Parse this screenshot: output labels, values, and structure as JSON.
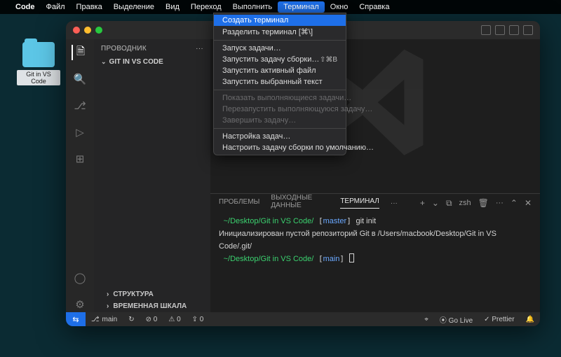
{
  "menubar": {
    "app": "Code",
    "items": [
      "Файл",
      "Правка",
      "Выделение",
      "Вид",
      "Переход",
      "Выполнить",
      "Терминал",
      "Окно",
      "Справка"
    ],
    "active_index": 6
  },
  "dropdown": {
    "items": [
      {
        "label": "Создать терминал",
        "shortcut": "",
        "hl": true
      },
      {
        "label": "Разделить терминал [⌘\\]",
        "shortcut": ""
      },
      {
        "sep": true
      },
      {
        "label": "Запуск задачи…",
        "shortcut": ""
      },
      {
        "label": "Запустить задачу сборки…",
        "shortcut": "⇧⌘B"
      },
      {
        "label": "Запустить активный файл",
        "shortcut": ""
      },
      {
        "label": "Запустить выбранный текст",
        "shortcut": ""
      },
      {
        "sep": true
      },
      {
        "label": "Показать выполняющиеся задачи…",
        "disabled": true
      },
      {
        "label": "Перезапустить выполняющуюся задачу…",
        "disabled": true
      },
      {
        "label": "Завершить задачу…",
        "disabled": true
      },
      {
        "sep": true
      },
      {
        "label": "Настройка задач…",
        "shortcut": ""
      },
      {
        "label": "Настроить задачу сборки по умолчанию…",
        "shortcut": ""
      }
    ]
  },
  "desktop": {
    "folder_label": "Git in VS Code"
  },
  "sidebar": {
    "title": "ПРОВОДНИК",
    "folder": "GIT IN VS CODE",
    "collapsed": [
      "СТРУКТУРА",
      "ВРЕМЕННАЯ ШКАЛА"
    ]
  },
  "panel": {
    "tabs": [
      "ПРОБЛЕМЫ",
      "ВЫХОДНЫЕ ДАННЫЕ",
      "ТЕРМИНАЛ"
    ],
    "active_tab": 2,
    "more": "···",
    "right": {
      "plus": "+",
      "add_dd": "⌄",
      "shell_icon": "⧉",
      "shell": "zsh",
      "trash": "🗑",
      "more": "···",
      "up": "⌃",
      "close": "✕"
    }
  },
  "terminal": {
    "prompt_icon": "",
    "path": "~/Desktop/Git in VS Code/",
    "branch1": "master",
    "cmd1": "git init",
    "output": "Инициализирован пустой репозиторий Git в /Users/macbook/Desktop/Git in VS Code/.git/",
    "branch2": "main"
  },
  "statusbar": {
    "remote": "⇆",
    "branch_icon": "⎇",
    "branch": "main",
    "sync": "↻",
    "errors": "⊘ 0",
    "warnings": "⚠ 0",
    "ports": "⇪ 0",
    "golive": "⦿ Go Live",
    "prettier": "✓ Prettier",
    "bell": "🔔"
  }
}
